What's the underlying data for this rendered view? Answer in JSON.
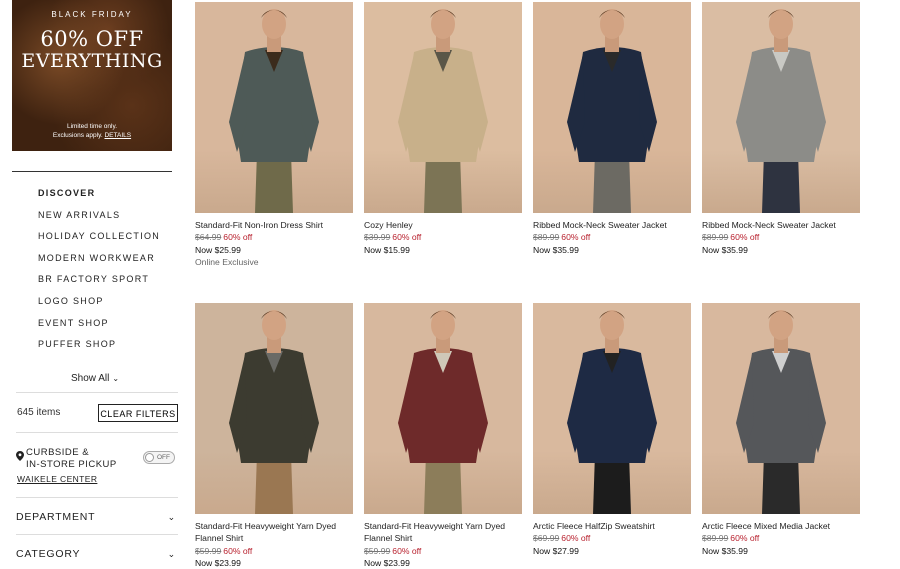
{
  "promo": {
    "kicker": "BLACK FRIDAY",
    "line1": "60% OFF",
    "line2": "EVERYTHING",
    "fine": "Limited time only.",
    "fine2": "Exclusions apply.",
    "details_link": "DETAILS"
  },
  "nav": {
    "heading": "DISCOVER",
    "items": [
      "NEW ARRIVALS",
      "HOLIDAY COLLECTION",
      "MODERN WORKWEAR",
      "BR FACTORY SPORT",
      "LOGO SHOP",
      "EVENT SHOP",
      "PUFFER SHOP"
    ],
    "show_all": "Show All"
  },
  "filters": {
    "item_count": "645 items",
    "clear_label": "CLEAR FILTERS",
    "pickup_line1": "CURBSIDE &",
    "pickup_line2": "IN-STORE PICKUP",
    "toggle_label": "OFF",
    "store_name": "WAIKELE CENTER",
    "department": "DEPARTMENT",
    "category": "CATEGORY"
  },
  "products": [
    {
      "name": "Standard-Fit Non-Iron Dress Shirt",
      "was": "$64.99",
      "off": "60% off",
      "now": "Now $25.99",
      "note": "Online Exclusive",
      "bg": "#d8b79c",
      "top": "#4e5a57",
      "bottom": "#6f6a4a",
      "accent": "#3b2b1c"
    },
    {
      "name": "Cozy Henley",
      "was": "$39.99",
      "off": "60% off",
      "now": "Now $15.99",
      "note": "",
      "bg": "#dcbda0",
      "top": "#c8b08a",
      "bottom": "#7c7455",
      "accent": "#5a5648"
    },
    {
      "name": "Ribbed Mock-Neck Sweater Jacket",
      "was": "$89.99",
      "off": "60% off",
      "now": "Now $35.99",
      "note": "",
      "bg": "#d9b699",
      "top": "#1f2a40",
      "bottom": "#6c6a63",
      "accent": "#2a2a2a"
    },
    {
      "name": "Ribbed Mock-Neck Sweater Jacket",
      "was": "$89.99",
      "off": "60% off",
      "now": "Now $35.99",
      "note": "",
      "bg": "#dabda3",
      "top": "#8c8c88",
      "bottom": "#2e3340",
      "accent": "#c9c9c4"
    },
    {
      "name": "Standard-Fit Heavyweight Yarn Dyed Flannel Shirt",
      "was": "$59.99",
      "off": "60% off",
      "now": "Now $23.99",
      "note": "",
      "bg": "#cdb49c",
      "top": "#3c3b30",
      "bottom": "#9a7752",
      "accent": "#6a6a66"
    },
    {
      "name": "Standard-Fit Heavyweight Yarn Dyed Flannel Shirt",
      "was": "$59.99",
      "off": "60% off",
      "now": "Now $23.99",
      "note": "",
      "bg": "#d7b89e",
      "top": "#6e2a2a",
      "bottom": "#8c7d5a",
      "accent": "#cfc8b8"
    },
    {
      "name": "Arctic Fleece HalfZip Sweatshirt",
      "was": "$69.99",
      "off": "60% off",
      "now": "Now $27.99",
      "note": "",
      "bg": "#d9b99e",
      "top": "#1e2a44",
      "bottom": "#1c1c1c",
      "accent": "#222222"
    },
    {
      "name": "Arctic Fleece Mixed Media Jacket",
      "was": "$89.99",
      "off": "60% off",
      "now": "Now $35.99",
      "note": "",
      "bg": "#d8b89e",
      "top": "#55575a",
      "bottom": "#2a2a2a",
      "accent": "#cfcfcf"
    }
  ]
}
